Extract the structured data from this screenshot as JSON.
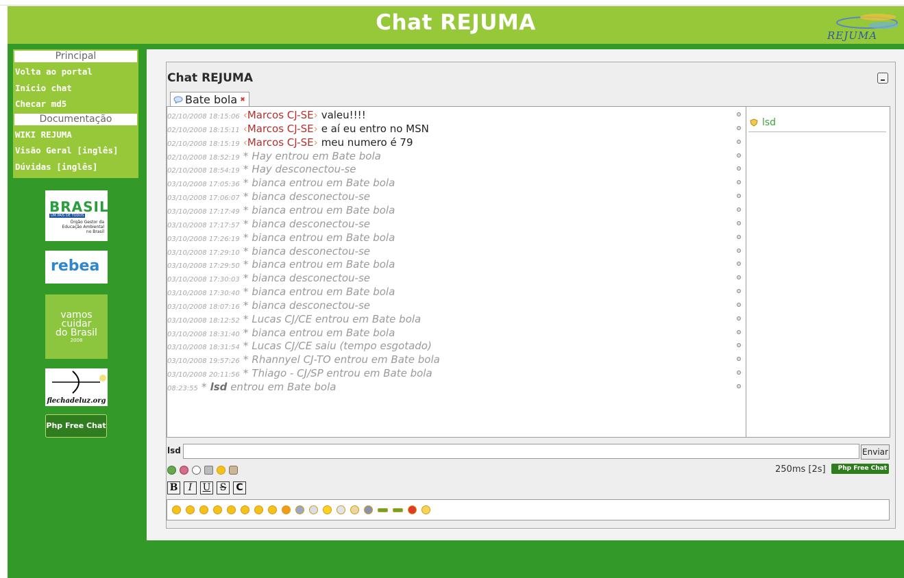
{
  "header": {
    "title": "Chat REJUMA",
    "logo_text": "REJUMA"
  },
  "sidebar": {
    "sections": [
      {
        "heading": "Principal",
        "items": [
          "Volta ao portal",
          "Início chat",
          "Checar md5"
        ]
      },
      {
        "heading": "Documentação",
        "items": [
          "WIKI REJUMA",
          "Visão Geral [inglês]",
          "Dúvidas [inglês]"
        ]
      }
    ],
    "banners": {
      "brasil": {
        "title": "BRASIL",
        "tagline": "UM PAÍS DE TODOS",
        "caption_1": "Órgão Gestor da",
        "caption_2": "Educação Ambiental",
        "caption_3": "no Brasil"
      },
      "rebea": {
        "title": "rebea"
      },
      "vamos": {
        "title_1": "vamos",
        "title_2": "cuidar",
        "title_3": "do Brasil",
        "year": "2008"
      },
      "flecha": {
        "caption": "flechadeluz.org"
      },
      "phpfreechat": {
        "label": "Php Free Chat"
      }
    }
  },
  "chat": {
    "panel_title": "Chat REJUMA",
    "tab_label": "Bate bola",
    "messages": [
      {
        "time": "02/10/2008 18:15:06",
        "nick": "Marcos CJ-SE",
        "text": "valeu!!!!"
      },
      {
        "time": "02/10/2008 18:15:11",
        "nick": "Marcos CJ-SE",
        "text": "e aí eu entro no MSN"
      },
      {
        "time": "02/10/2008 18:15:19",
        "nick": "Marcos CJ-SE",
        "text": "meu numero é 79"
      },
      {
        "time": "02/10/2008 18:52:19",
        "text": "Hay entrou em Bate bola"
      },
      {
        "time": "02/10/2008 18:54:19",
        "text": "Hay desconectou-se"
      },
      {
        "time": "03/10/2008 17:05:36",
        "text": "bianca entrou em Bate bola"
      },
      {
        "time": "03/10/2008 17:06:07",
        "text": "bianca desconectou-se"
      },
      {
        "time": "03/10/2008 17:17:49",
        "text": "bianca entrou em Bate bola"
      },
      {
        "time": "03/10/2008 17:17:57",
        "text": "bianca desconectou-se"
      },
      {
        "time": "03/10/2008 17:26:19",
        "text": "bianca entrou em Bate bola"
      },
      {
        "time": "03/10/2008 17:29:10",
        "text": "bianca desconectou-se"
      },
      {
        "time": "03/10/2008 17:29:50",
        "text": "bianca entrou em Bate bola"
      },
      {
        "time": "03/10/2008 17:30:03",
        "text": "bianca desconectou-se"
      },
      {
        "time": "03/10/2008 17:30:40",
        "text": "bianca entrou em Bate bola"
      },
      {
        "time": "03/10/2008 18:07:16",
        "text": "bianca desconectou-se"
      },
      {
        "time": "03/10/2008 18:12:52",
        "text": "Lucas CJ/CE entrou em Bate bola"
      },
      {
        "time": "03/10/2008 18:31:40",
        "text": "bianca entrou em Bate bola"
      },
      {
        "time": "03/10/2008 18:31:54",
        "text": "Lucas CJ/CE saiu (tempo esgotado)"
      },
      {
        "time": "03/10/2008 19:57:26",
        "text": "Rhannyel CJ-TO entrou em Bate bola"
      },
      {
        "time": "03/10/2008 20:11:56",
        "text": "Thiago - CJ/SP entrou em Bate bola"
      },
      {
        "time": "08:23:55",
        "nick_bold": "lsd",
        "text": "entrou em Bate bola"
      }
    ],
    "users": [
      "lsd"
    ],
    "current_nick": "lsd",
    "input_value": "",
    "send_label": "Enviar",
    "status": "250ms [2s]",
    "pfc_badge": "Php Free Chat",
    "format_buttons": [
      "B",
      "I",
      "U",
      "S",
      "C"
    ]
  },
  "colors": {
    "header_green": "#97c83a",
    "body_green": "#339a2a",
    "nick_red": "#b2302a",
    "user_green": "#3aa53a"
  },
  "icons": {
    "tools": [
      "globe-icon",
      "users-icon",
      "clock-icon",
      "sound-icon",
      "smiley-icon",
      "person-icon"
    ],
    "smileys": [
      "smile",
      "wink",
      "grin",
      "sad",
      "tongue",
      "surprised",
      "neutral",
      "cool",
      "angry",
      "cloud",
      "umbrella",
      "sun",
      "cloud-sun",
      "partly-cloudy",
      "storm",
      "arrow-right",
      "arrow-left",
      "warning",
      "lightbulb"
    ]
  }
}
